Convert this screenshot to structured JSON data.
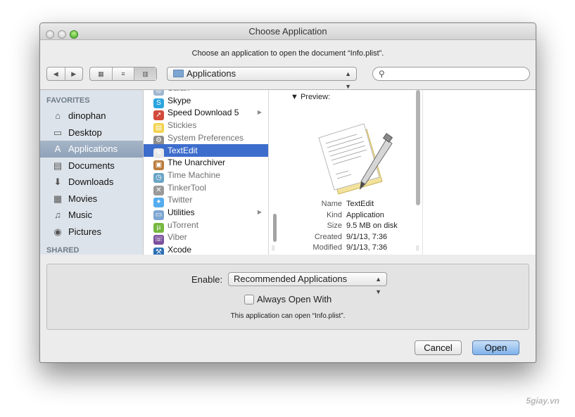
{
  "window": {
    "title": "Choose Application"
  },
  "prompt": "Choose an application to open the document “Info.plist”.",
  "toolbar": {
    "back_label": "◀",
    "forward_label": "▶",
    "view_icon_label": "▦",
    "view_list_label": "≡",
    "view_column_label": "▥",
    "location": "Applications",
    "search_placeholder": ""
  },
  "sidebar": {
    "favorites_header": "FAVORITES",
    "shared_header": "SHARED",
    "items": [
      {
        "label": "dinophan",
        "icon": "home-icon",
        "glyph": "⌂"
      },
      {
        "label": "Desktop",
        "icon": "desktop-icon",
        "glyph": "▭"
      },
      {
        "label": "Applications",
        "icon": "applications-icon",
        "glyph": "A",
        "selected": true
      },
      {
        "label": "Documents",
        "icon": "documents-icon",
        "glyph": "▤"
      },
      {
        "label": "Downloads",
        "icon": "downloads-icon",
        "glyph": "⬇"
      },
      {
        "label": "Movies",
        "icon": "movies-icon",
        "glyph": "▦"
      },
      {
        "label": "Music",
        "icon": "music-icon",
        "glyph": "♫"
      },
      {
        "label": "Pictures",
        "icon": "pictures-icon",
        "glyph": "◉"
      }
    ]
  },
  "apps": [
    {
      "label": "Safari",
      "dim": true,
      "color": "#9fb6cf",
      "glyph": "◎"
    },
    {
      "label": "Skype",
      "color": "#2aa5e0",
      "glyph": "S"
    },
    {
      "label": "Speed Download 5",
      "color": "#d24a3a",
      "glyph": "➚",
      "folder": true
    },
    {
      "label": "Stickies",
      "dim": true,
      "color": "#f2d24b",
      "glyph": "▤"
    },
    {
      "label": "System Preferences",
      "dim": true,
      "color": "#8d8d8d",
      "glyph": "⚙"
    },
    {
      "label": "TextEdit",
      "selected": true,
      "color": "#e8e8e8",
      "glyph": "✎"
    },
    {
      "label": "The Unarchiver",
      "color": "#b87a3a",
      "glyph": "▣"
    },
    {
      "label": "Time Machine",
      "dim": true,
      "color": "#6aa4c6",
      "glyph": "◷"
    },
    {
      "label": "TinkerTool",
      "dim": true,
      "color": "#9a9a9a",
      "glyph": "✕"
    },
    {
      "label": "Twitter",
      "dim": true,
      "color": "#55acee",
      "glyph": "✦"
    },
    {
      "label": "Utilities",
      "color": "#7ea6d2",
      "glyph": "▭",
      "folder": true
    },
    {
      "label": "uTorrent",
      "dim": true,
      "color": "#76b83f",
      "glyph": "µ"
    },
    {
      "label": "Viber",
      "dim": true,
      "color": "#7b519d",
      "glyph": "☏"
    },
    {
      "label": "Xcode",
      "color": "#2a6fb4",
      "glyph": "⚒"
    }
  ],
  "preview": {
    "header": "▼ Preview:",
    "rows": [
      {
        "key": "Name",
        "value": "TextEdit"
      },
      {
        "key": "Kind",
        "value": "Application"
      },
      {
        "key": "Size",
        "value": "9.5 MB on disk"
      },
      {
        "key": "Created",
        "value": "9/1/13, 7:36"
      },
      {
        "key": "Modified",
        "value": "9/1/13, 7:36"
      }
    ]
  },
  "options": {
    "enable_label": "Enable:",
    "enable_value": "Recommended Applications",
    "always_open_label": "Always Open With",
    "always_open_checked": false,
    "info": "This application can open “Info.plist”."
  },
  "buttons": {
    "cancel": "Cancel",
    "open": "Open"
  },
  "watermark": "5giay.vn"
}
